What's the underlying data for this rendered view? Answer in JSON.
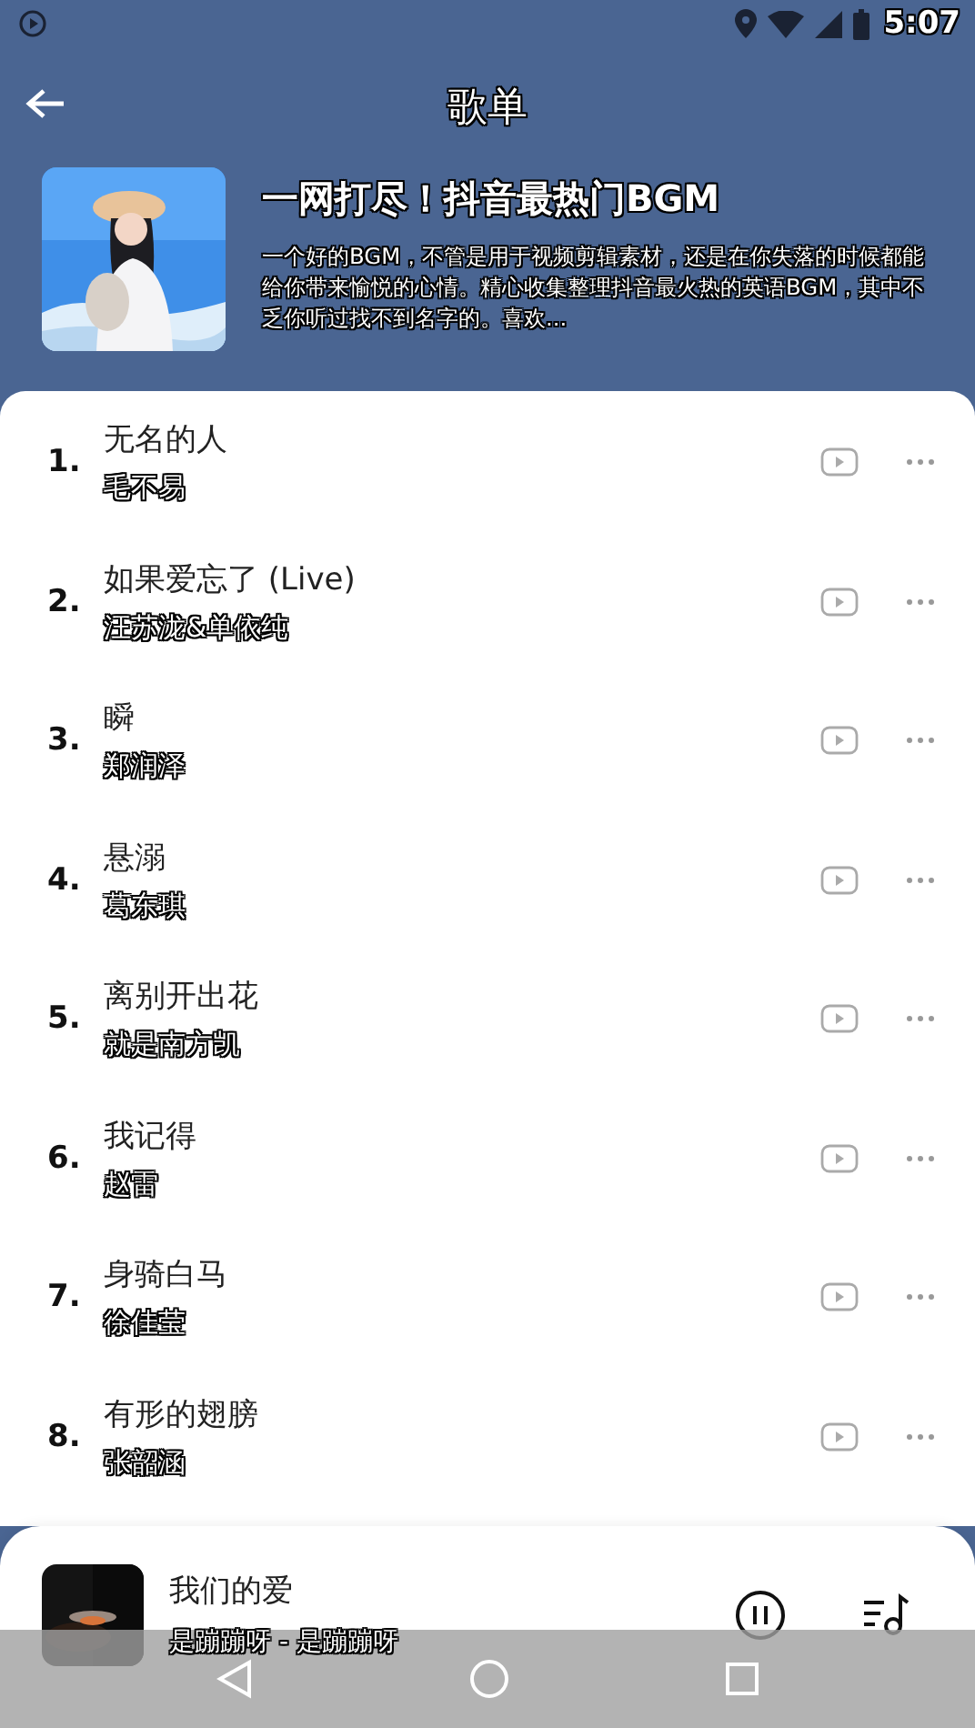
{
  "status_bar": {
    "time": "5:07"
  },
  "toolbar": {
    "title": "歌单"
  },
  "playlist": {
    "title": "一网打尽！抖音最热门BGM",
    "description": "一个好的BGM，不管是用于视频剪辑素材，还是在你失落的时候都能给你带来愉悦的心情。精心收集整理抖音最火热的英语BGM，其中不乏你听过找不到名字的。喜欢..."
  },
  "songs": [
    {
      "number": "1.",
      "title": "无名的人",
      "artist": "毛不易"
    },
    {
      "number": "2.",
      "title": "如果爱忘了 (Live)",
      "artist": "汪苏泷&单依纯"
    },
    {
      "number": "3.",
      "title": "瞬",
      "artist": "郑润泽"
    },
    {
      "number": "4.",
      "title": "悬溺",
      "artist": "葛东琪"
    },
    {
      "number": "5.",
      "title": "离别开出花",
      "artist": "就是南方凯"
    },
    {
      "number": "6.",
      "title": "我记得",
      "artist": "赵雷"
    },
    {
      "number": "7.",
      "title": "身骑白马",
      "artist": "徐佳莹"
    },
    {
      "number": "8.",
      "title": "有形的翅膀",
      "artist": "张韶涵"
    }
  ],
  "now_playing": {
    "title": "我们的爱",
    "subtitle": "是蹦蹦呀 - 是蹦蹦呀",
    "playing": true
  }
}
